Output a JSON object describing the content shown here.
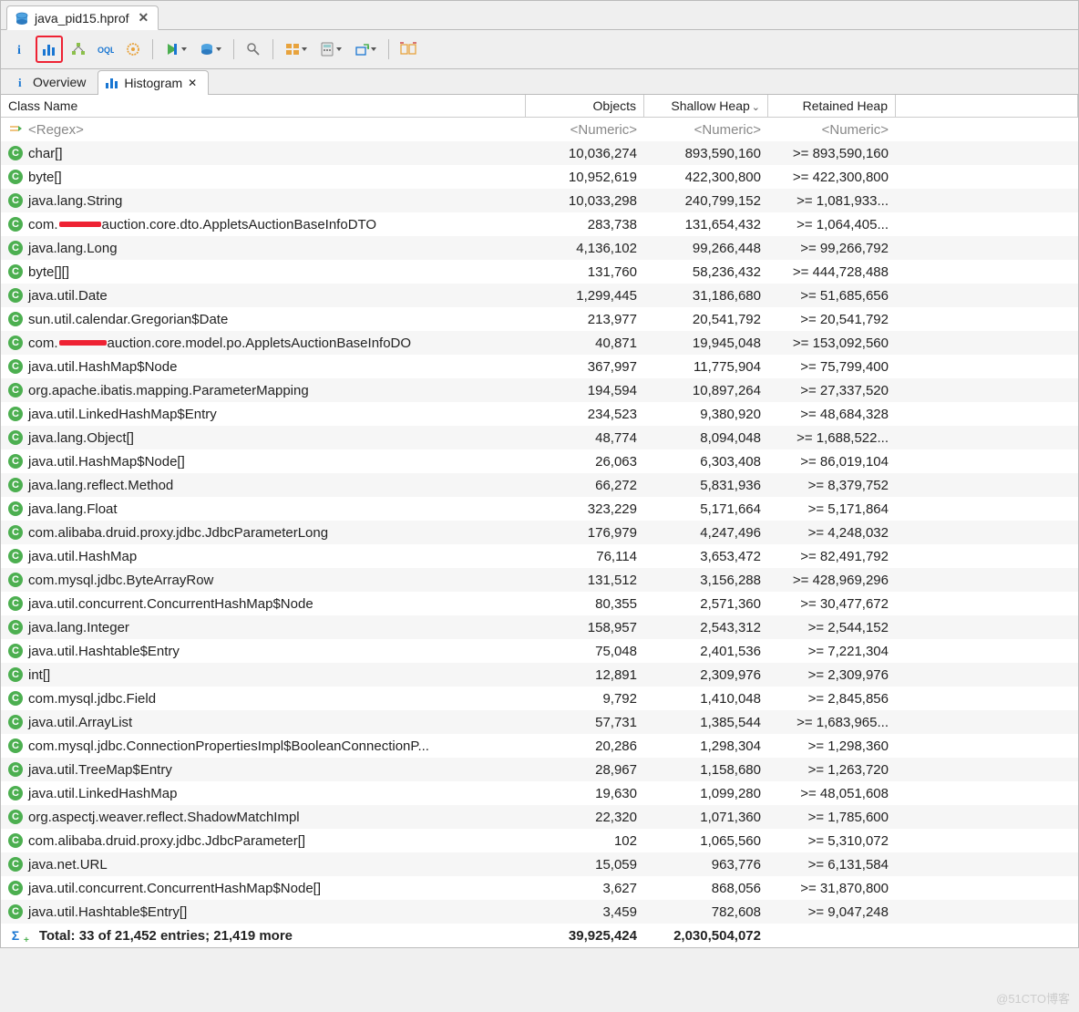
{
  "file_tab": {
    "title": "java_pid15.hprof"
  },
  "view_tabs": {
    "overview": "Overview",
    "histogram": "Histogram"
  },
  "columns": {
    "class": "Class Name",
    "objects": "Objects",
    "shallow": "Shallow Heap",
    "retained": "Retained Heap"
  },
  "regex_row": {
    "class": "<Regex>",
    "objects": "<Numeric>",
    "shallow": "<Numeric>",
    "retained": "<Numeric>"
  },
  "rows": [
    {
      "class": "char[]",
      "objects": "10,036,274",
      "shallow": "893,590,160",
      "retained": ">= 893,590,160"
    },
    {
      "class": "byte[]",
      "objects": "10,952,619",
      "shallow": "422,300,800",
      "retained": ">= 422,300,800"
    },
    {
      "class": "java.lang.String",
      "objects": "10,033,298",
      "shallow": "240,799,152",
      "retained": ">= 1,081,933..."
    },
    {
      "class": "com.",
      "redact": "w1",
      "class2": "auction.core.dto.AppletsAuctionBaseInfoDTO",
      "objects": "283,738",
      "shallow": "131,654,432",
      "retained": ">= 1,064,405..."
    },
    {
      "class": "java.lang.Long",
      "objects": "4,136,102",
      "shallow": "99,266,448",
      "retained": ">= 99,266,792"
    },
    {
      "class": "byte[][]",
      "objects": "131,760",
      "shallow": "58,236,432",
      "retained": ">= 444,728,488"
    },
    {
      "class": "java.util.Date",
      "objects": "1,299,445",
      "shallow": "31,186,680",
      "retained": ">= 51,685,656"
    },
    {
      "class": "sun.util.calendar.Gregorian$Date",
      "objects": "213,977",
      "shallow": "20,541,792",
      "retained": ">= 20,541,792"
    },
    {
      "class": "com.",
      "redact": "w2",
      "class2": "auction.core.model.po.AppletsAuctionBaseInfoDO",
      "objects": "40,871",
      "shallow": "19,945,048",
      "retained": ">= 153,092,560"
    },
    {
      "class": "java.util.HashMap$Node",
      "objects": "367,997",
      "shallow": "11,775,904",
      "retained": ">= 75,799,400"
    },
    {
      "class": "org.apache.ibatis.mapping.ParameterMapping",
      "objects": "194,594",
      "shallow": "10,897,264",
      "retained": ">= 27,337,520"
    },
    {
      "class": "java.util.LinkedHashMap$Entry",
      "objects": "234,523",
      "shallow": "9,380,920",
      "retained": ">= 48,684,328"
    },
    {
      "class": "java.lang.Object[]",
      "objects": "48,774",
      "shallow": "8,094,048",
      "retained": ">= 1,688,522..."
    },
    {
      "class": "java.util.HashMap$Node[]",
      "objects": "26,063",
      "shallow": "6,303,408",
      "retained": ">= 86,019,104"
    },
    {
      "class": "java.lang.reflect.Method",
      "objects": "66,272",
      "shallow": "5,831,936",
      "retained": ">= 8,379,752"
    },
    {
      "class": "java.lang.Float",
      "objects": "323,229",
      "shallow": "5,171,664",
      "retained": ">= 5,171,864"
    },
    {
      "class": "com.alibaba.druid.proxy.jdbc.JdbcParameterLong",
      "objects": "176,979",
      "shallow": "4,247,496",
      "retained": ">= 4,248,032"
    },
    {
      "class": "java.util.HashMap",
      "objects": "76,114",
      "shallow": "3,653,472",
      "retained": ">= 82,491,792"
    },
    {
      "class": "com.mysql.jdbc.ByteArrayRow",
      "objects": "131,512",
      "shallow": "3,156,288",
      "retained": ">= 428,969,296"
    },
    {
      "class": "java.util.concurrent.ConcurrentHashMap$Node",
      "objects": "80,355",
      "shallow": "2,571,360",
      "retained": ">= 30,477,672"
    },
    {
      "class": "java.lang.Integer",
      "objects": "158,957",
      "shallow": "2,543,312",
      "retained": ">= 2,544,152"
    },
    {
      "class": "java.util.Hashtable$Entry",
      "objects": "75,048",
      "shallow": "2,401,536",
      "retained": ">= 7,221,304"
    },
    {
      "class": "int[]",
      "objects": "12,891",
      "shallow": "2,309,976",
      "retained": ">= 2,309,976"
    },
    {
      "class": "com.mysql.jdbc.Field",
      "objects": "9,792",
      "shallow": "1,410,048",
      "retained": ">= 2,845,856"
    },
    {
      "class": "java.util.ArrayList",
      "objects": "57,731",
      "shallow": "1,385,544",
      "retained": ">= 1,683,965..."
    },
    {
      "class": "com.mysql.jdbc.ConnectionPropertiesImpl$BooleanConnectionP...",
      "objects": "20,286",
      "shallow": "1,298,304",
      "retained": ">= 1,298,360"
    },
    {
      "class": "java.util.TreeMap$Entry",
      "objects": "28,967",
      "shallow": "1,158,680",
      "retained": ">= 1,263,720"
    },
    {
      "class": "java.util.LinkedHashMap",
      "objects": "19,630",
      "shallow": "1,099,280",
      "retained": ">= 48,051,608"
    },
    {
      "class": "org.aspectj.weaver.reflect.ShadowMatchImpl",
      "objects": "22,320",
      "shallow": "1,071,360",
      "retained": ">= 1,785,600"
    },
    {
      "class": "com.alibaba.druid.proxy.jdbc.JdbcParameter[]",
      "objects": "102",
      "shallow": "1,065,560",
      "retained": ">= 5,310,072"
    },
    {
      "class": "java.net.URL",
      "objects": "15,059",
      "shallow": "963,776",
      "retained": ">= 6,131,584"
    },
    {
      "class": "java.util.concurrent.ConcurrentHashMap$Node[]",
      "objects": "3,627",
      "shallow": "868,056",
      "retained": ">= 31,870,800"
    },
    {
      "class": "java.util.Hashtable$Entry[]",
      "objects": "3,459",
      "shallow": "782,608",
      "retained": ">= 9,047,248"
    }
  ],
  "total": {
    "label": "Total: 33 of 21,452 entries; 21,419 more",
    "objects": "39,925,424",
    "shallow": "2,030,504,072",
    "retained": ""
  },
  "watermark": "@51CTO博客"
}
